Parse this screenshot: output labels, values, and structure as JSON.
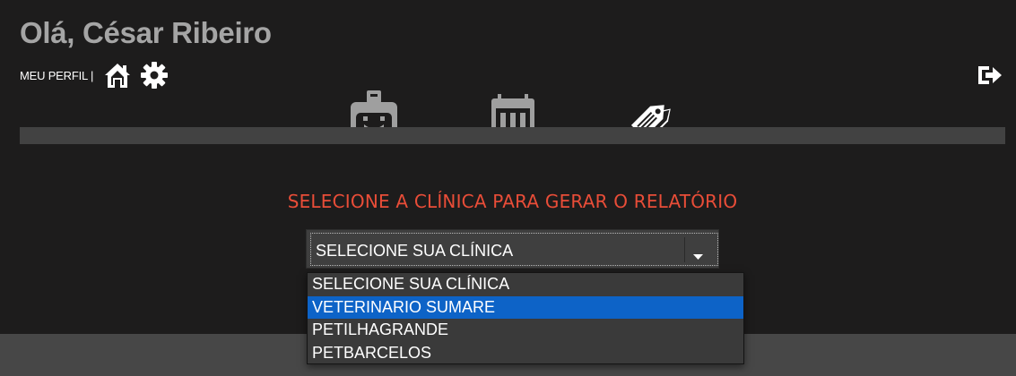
{
  "header": {
    "greeting": "Olá, César Ribeiro",
    "profile_link": "MEU PERFIL",
    "separator": "|",
    "icons": [
      "home-icon",
      "gear-icon",
      "logout-icon"
    ]
  },
  "nav": {
    "icons": [
      "badge-icon",
      "calendar-icon",
      "tags-icon"
    ],
    "active": "tags-icon"
  },
  "main": {
    "heading": "SELECIONE A CLÍNICA PARA GERAR O RELATÓRIO",
    "select": {
      "current_value": "SELECIONE SUA CLÍNICA",
      "options": [
        "SELECIONE SUA CLÍNICA",
        "VETERINARIO SUMARE",
        "PETILHAGRANDE",
        "PETBARCELOS"
      ],
      "highlighted_option": "VETERINARIO SUMARE"
    }
  },
  "colors": {
    "background": "#1d1c1c",
    "heading": "#e94d38",
    "highlight": "#0d63c7",
    "tabbar": "#424242",
    "greeting": "#a5a5a5"
  }
}
